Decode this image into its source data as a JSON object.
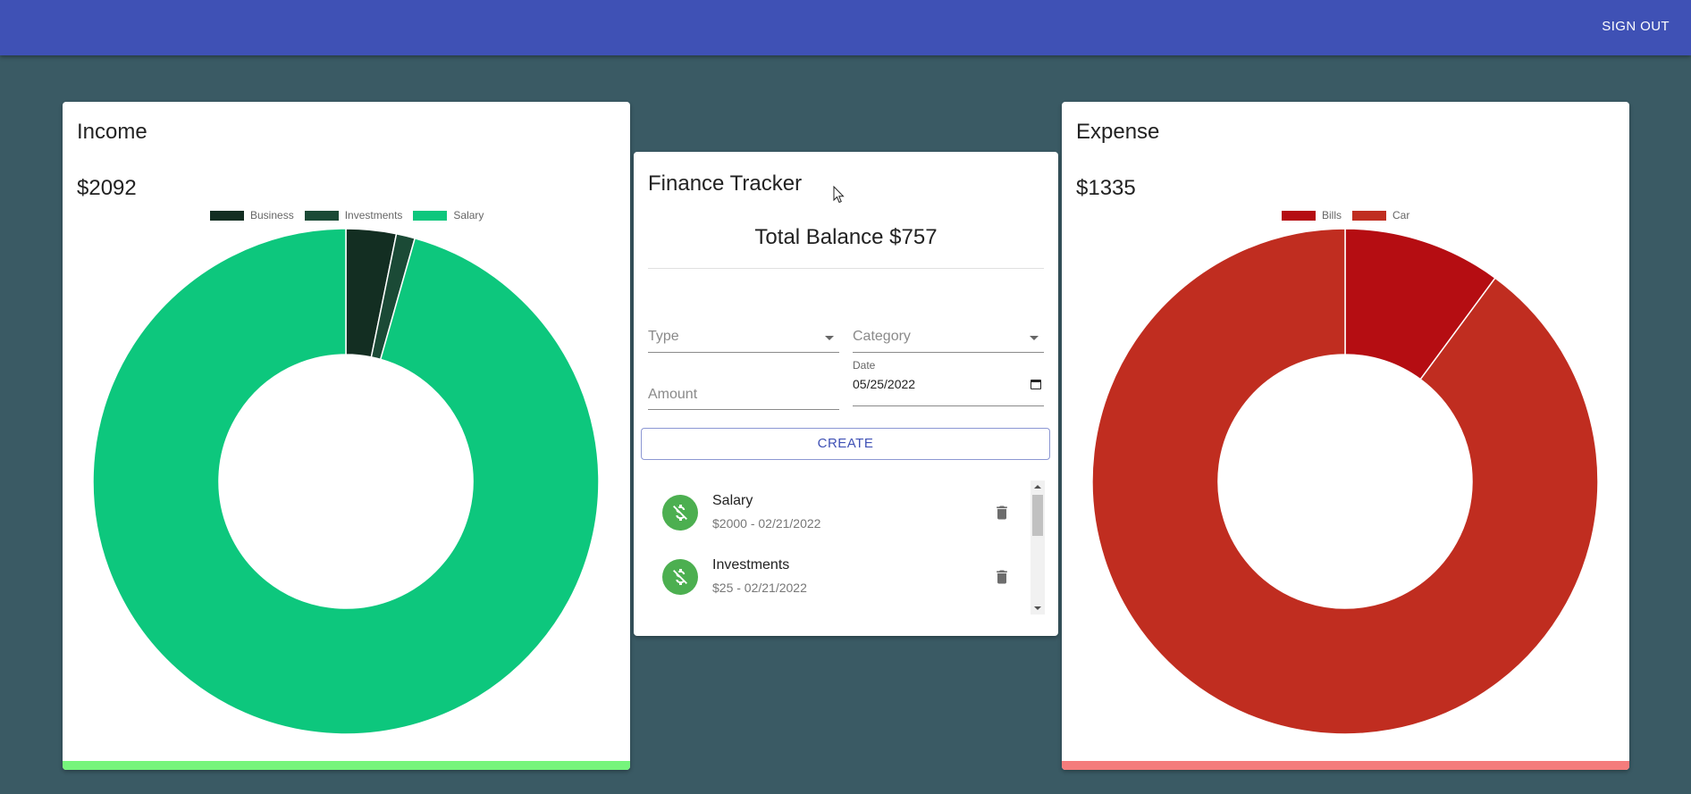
{
  "appbar": {
    "signout_label": "SIGN OUT",
    "color": "#3f51b5"
  },
  "income": {
    "title": "Income",
    "total": "$2092",
    "bar_color": "#76f57c",
    "chart_data": {
      "type": "pie",
      "categories": [
        "Business",
        "Investments",
        "Salary"
      ],
      "values": [
        67,
        25,
        2000
      ],
      "colors": [
        "#132e22",
        "#1b4a36",
        "#0dc77d"
      ],
      "legend": "top-center"
    }
  },
  "tracker": {
    "title": "Finance Tracker",
    "balance": "Total Balance $757",
    "type_placeholder": "Type",
    "category_placeholder": "Category",
    "amount_placeholder": "Amount",
    "date_label": "Date",
    "date_value": "05/25/2022",
    "create_label": "CREATE",
    "transactions": [
      {
        "category": "Salary",
        "detail": "$2000 - 02/21/2022"
      },
      {
        "category": "Investments",
        "detail": "$25 - 02/21/2022"
      }
    ]
  },
  "expense": {
    "title": "Expense",
    "total": "$1335",
    "bar_color": "#f47c7c",
    "chart_data": {
      "type": "pie",
      "categories": [
        "Bills",
        "Car"
      ],
      "values": [
        135,
        1200
      ],
      "colors": [
        "#b50d12",
        "#c02d20"
      ],
      "legend": "top-center"
    }
  },
  "icons": {
    "avatar": "money-off-icon",
    "delete": "trash-icon",
    "cursor": "mouse-pointer-icon"
  }
}
